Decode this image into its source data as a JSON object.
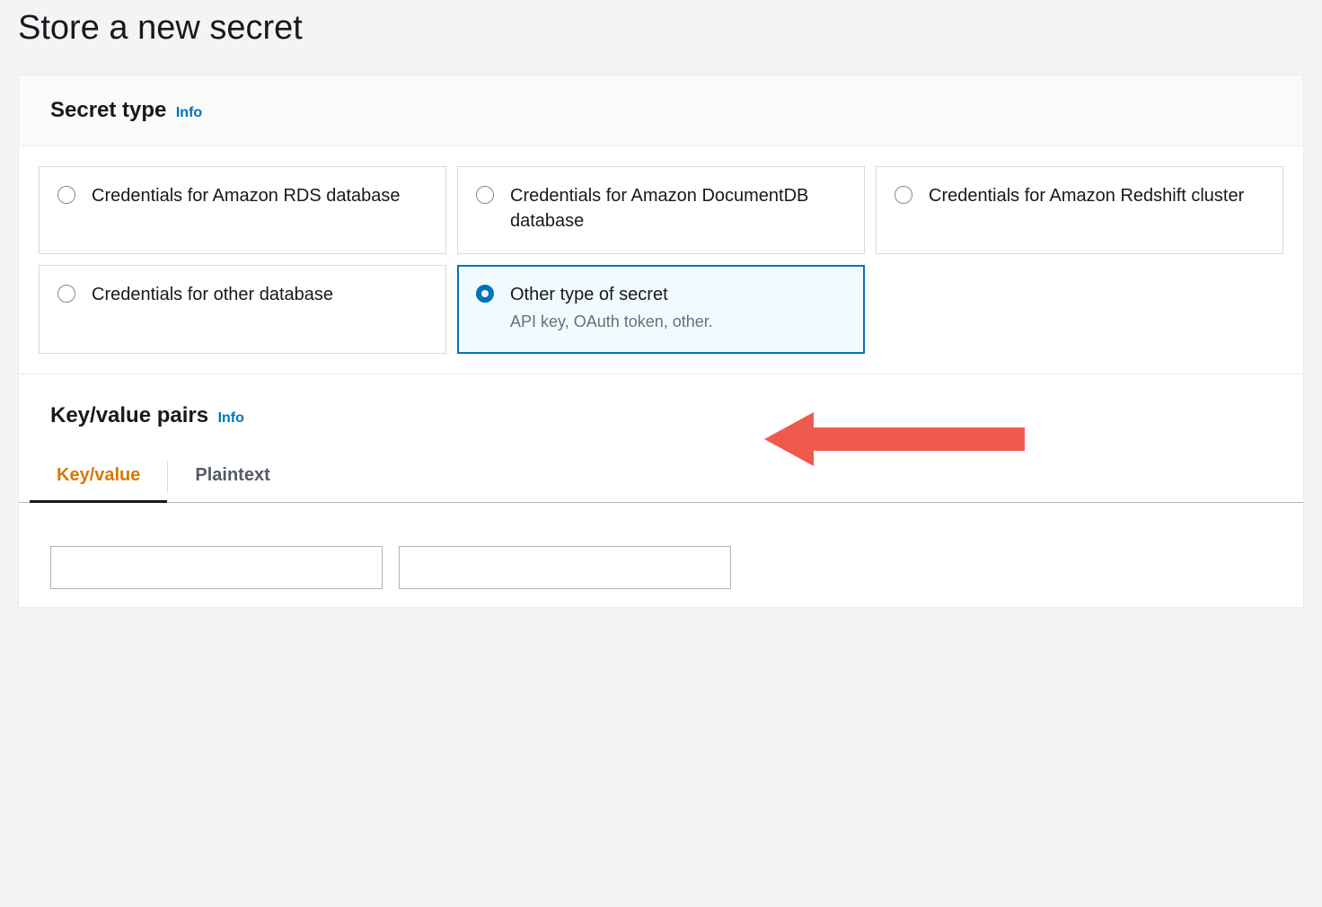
{
  "page": {
    "title": "Store a new secret"
  },
  "secretType": {
    "heading": "Secret type",
    "infoLabel": "Info",
    "options": [
      {
        "label": "Credentials for Amazon RDS database",
        "desc": "",
        "selected": false
      },
      {
        "label": "Credentials for Amazon DocumentDB database",
        "desc": "",
        "selected": false
      },
      {
        "label": "Credentials for Amazon Redshift cluster",
        "desc": "",
        "selected": false
      },
      {
        "label": "Credentials for other database",
        "desc": "",
        "selected": false
      },
      {
        "label": "Other type of secret",
        "desc": "API key, OAuth token, other.",
        "selected": true
      }
    ]
  },
  "keyValue": {
    "heading": "Key/value pairs",
    "infoLabel": "Info",
    "tabs": {
      "keyValue": "Key/value",
      "plaintext": "Plaintext",
      "active": "keyValue"
    },
    "inputs": {
      "keyValue": "",
      "keyPlaceholder": "",
      "valueValue": "",
      "valuePlaceholder": ""
    }
  },
  "colors": {
    "accent": "#0073bb",
    "tabActive": "#d97706",
    "arrow": "#ef5a4c"
  }
}
